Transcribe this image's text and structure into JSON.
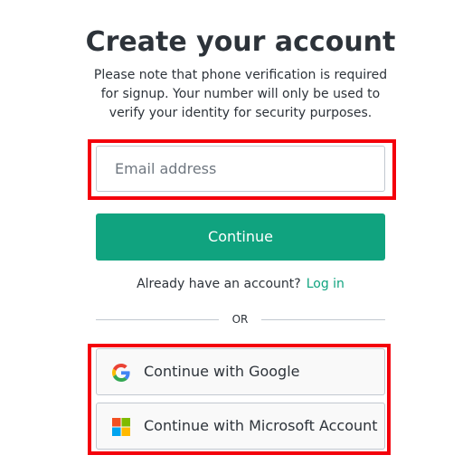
{
  "header": {
    "title": "Create your account",
    "subtitle": "Please note that phone verification is required for signup. Your number will only be used to verify your identity for security purposes."
  },
  "form": {
    "email_placeholder": "Email address",
    "email_value": "",
    "continue_label": "Continue"
  },
  "login": {
    "prompt": "Already have an account?",
    "link_label": "Log in"
  },
  "divider": {
    "label": "OR"
  },
  "social": {
    "google_label": "Continue with Google",
    "microsoft_label": "Continue with Microsoft Account"
  },
  "colors": {
    "accent": "#10a37f",
    "highlight_box": "#f4000b",
    "text": "#2d333a",
    "border": "#c2c8d0"
  },
  "icons": [
    "google-icon",
    "microsoft-icon"
  ]
}
